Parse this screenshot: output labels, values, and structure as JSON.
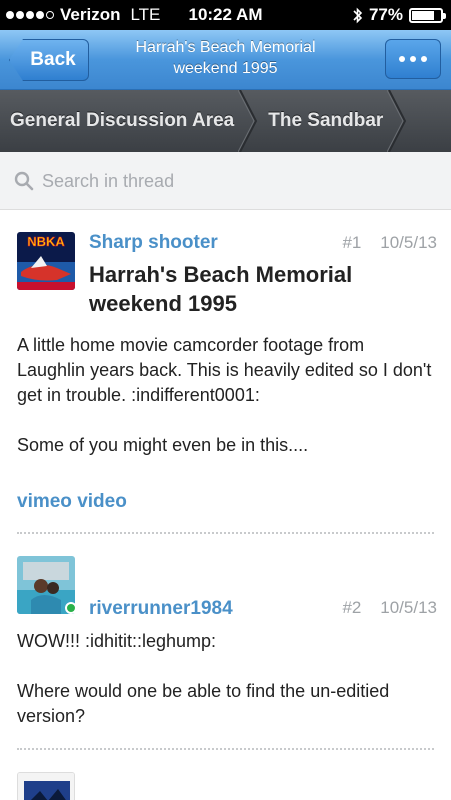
{
  "status_bar": {
    "carrier": "Verizon",
    "network": "LTE",
    "time": "10:22 AM",
    "battery": "77%",
    "battery_level": 0.77,
    "signal_bars": 4
  },
  "navbar": {
    "back_label": "Back",
    "title": "Harrah's Beach Memorial weekend 1995",
    "more_icon": "ellipsis-icon"
  },
  "breadcrumb": {
    "items": [
      "General Discussion Area",
      "The Sandbar"
    ]
  },
  "search": {
    "placeholder": "Search in thread"
  },
  "posts": [
    {
      "author": "Sharp shooter",
      "number": "#1",
      "date": "10/5/13",
      "title": "Harrah's Beach Memorial weekend 1995",
      "body": "A little home movie camcorder footage from Laughlin years back. This is heavily edited so I don't get in trouble. :indifferent0001:\n\nSome of you might even be in this....",
      "link": "vimeo video",
      "avatar_text": "NBKA"
    },
    {
      "author": "riverrunner1984",
      "number": "#2",
      "date": "10/5/13",
      "body": "WOW!!!  :idhitit::leghump:\n\nWhere would one be able to find the un-editied version?",
      "online": true
    }
  ],
  "colors": {
    "nav_blue": "#4a96dc",
    "link_blue": "#4a90c8",
    "online_green": "#29b14a"
  }
}
